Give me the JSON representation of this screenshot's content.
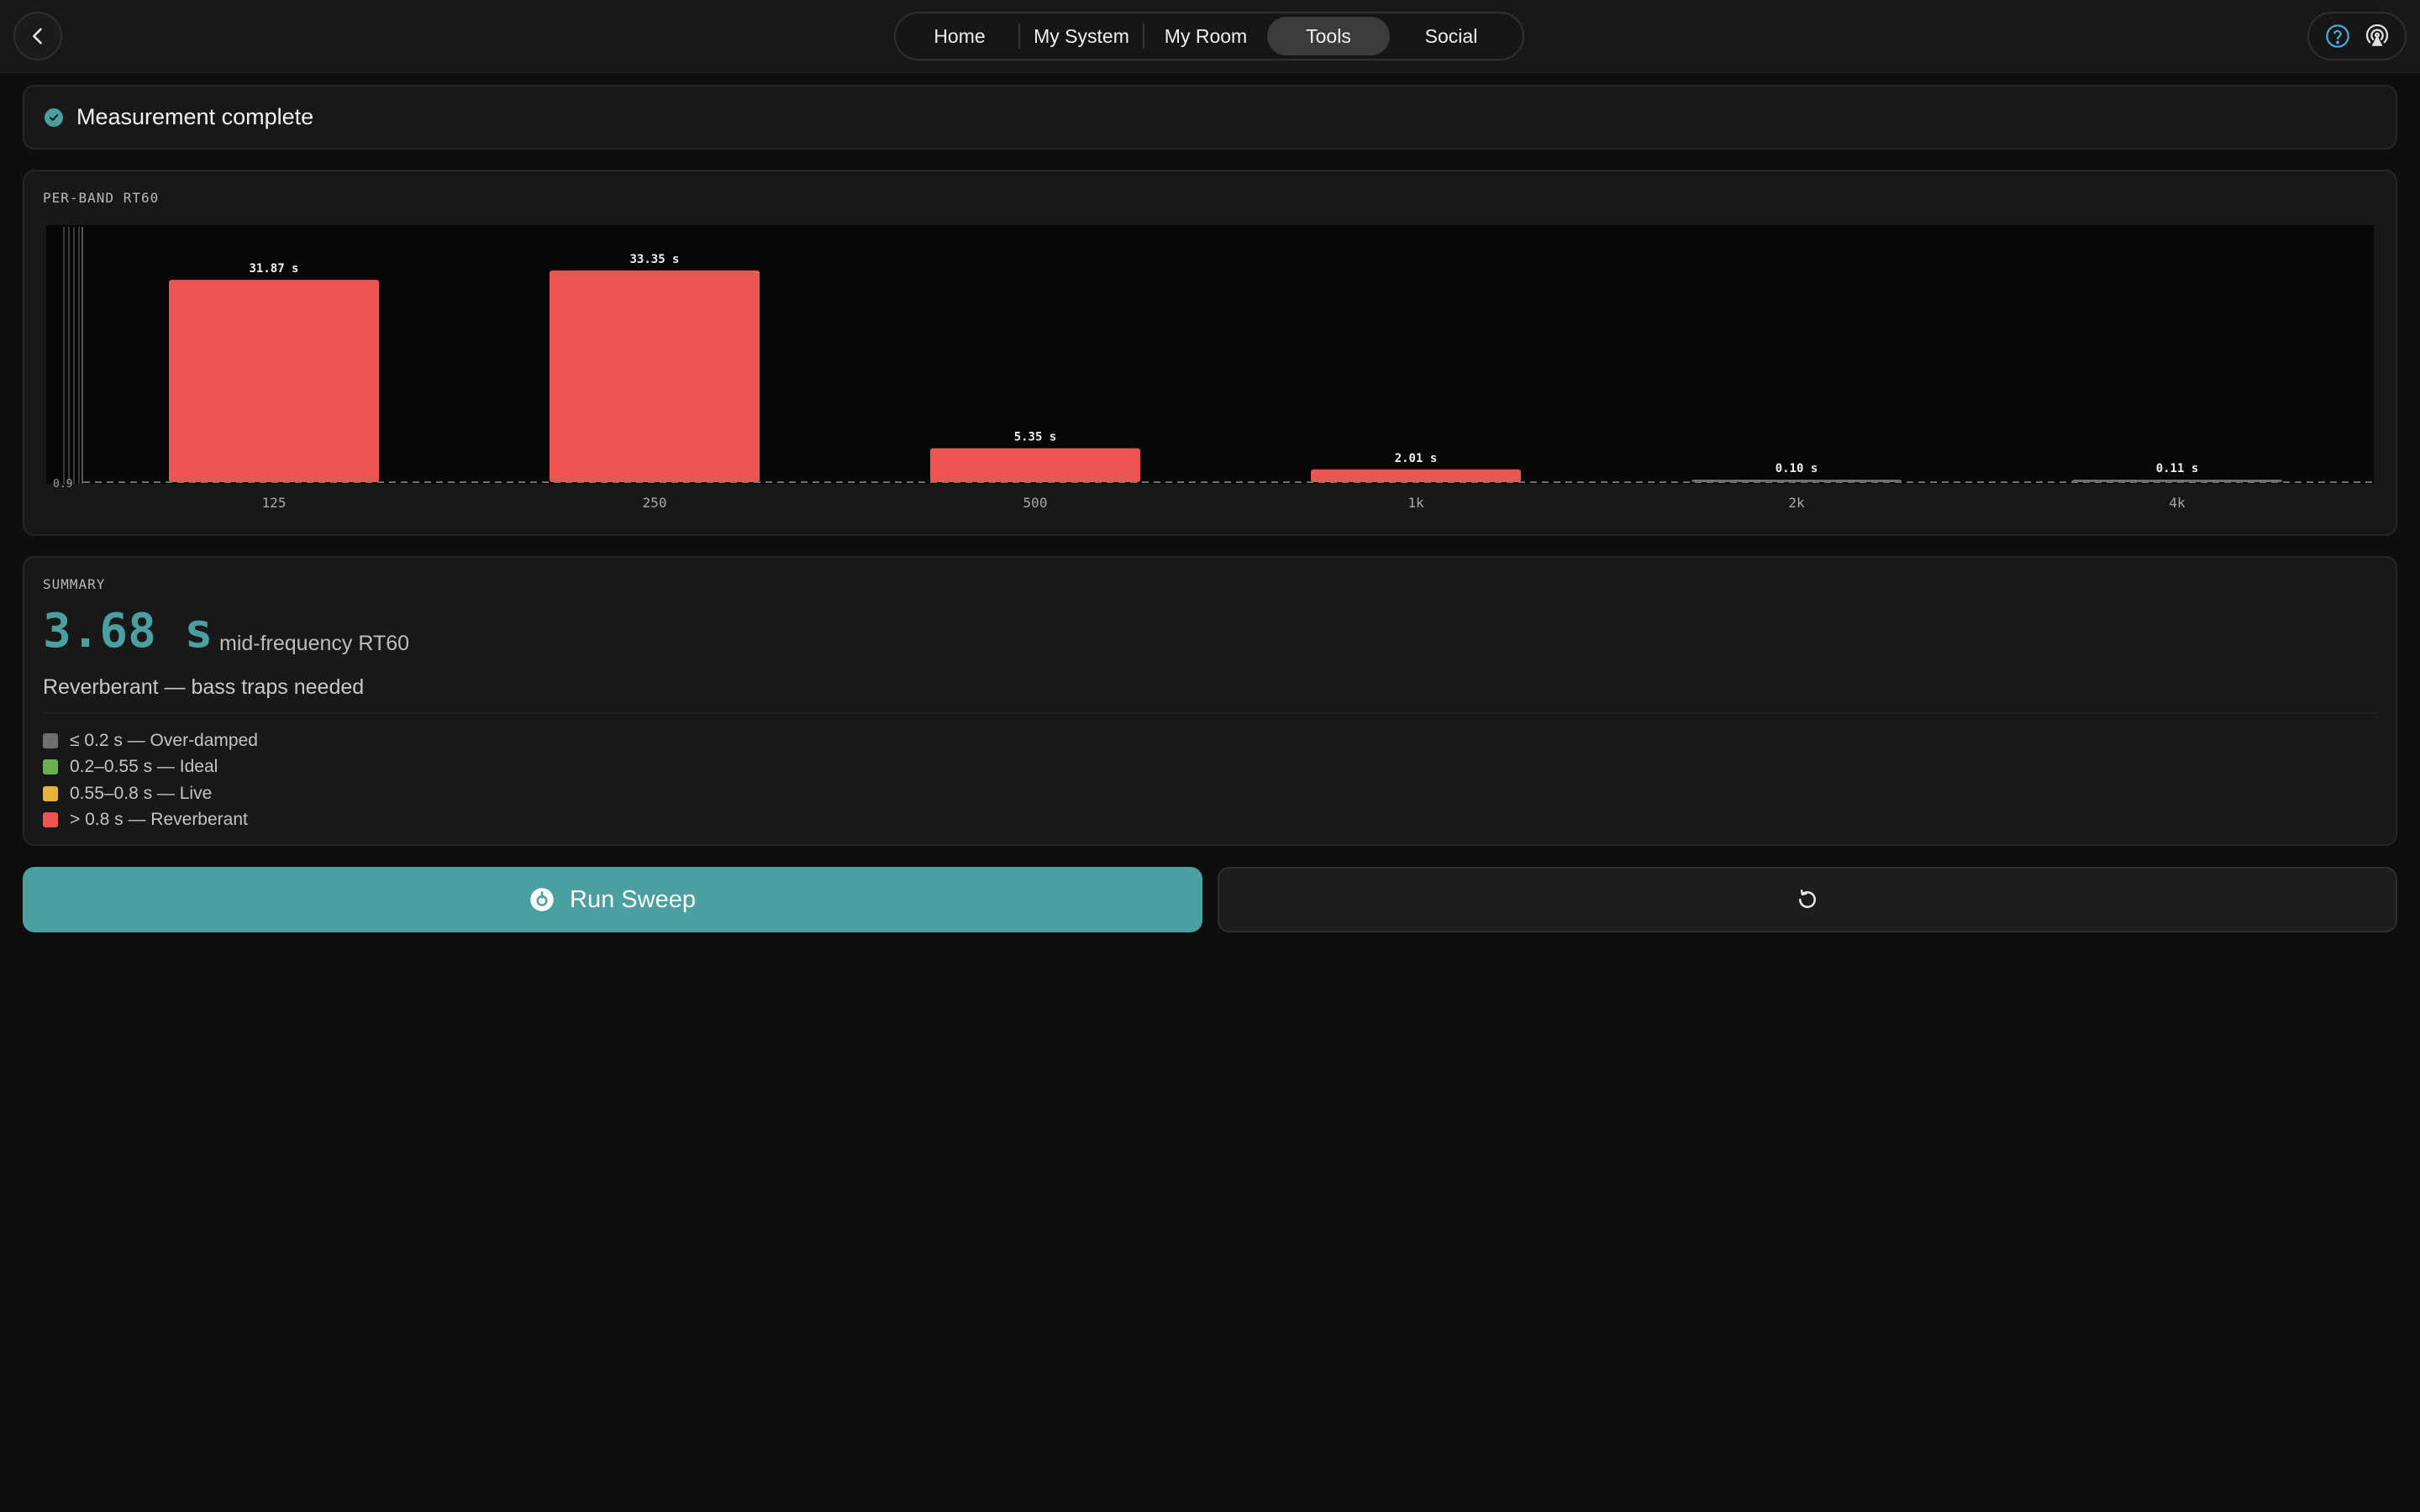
{
  "nav": {
    "tabs": [
      {
        "label": "Home",
        "active": false
      },
      {
        "label": "My System",
        "active": false
      },
      {
        "label": "My Room",
        "active": false
      },
      {
        "label": "Tools",
        "active": true
      },
      {
        "label": "Social",
        "active": false
      }
    ]
  },
  "icons": {
    "back": "chevron-left-icon",
    "help": "help-circle-icon",
    "broadcast": "airplay-icon",
    "status": "check-circle-icon",
    "run": "sweep-icon",
    "reset": "rotate-ccw-icon"
  },
  "status": {
    "text": "Measurement complete"
  },
  "chart": {
    "section_label": "PER-BAND RT60"
  },
  "chart_data": {
    "type": "bar",
    "title": "PER-BAND RT60",
    "categories": [
      "125",
      "250",
      "500",
      "1k",
      "2k",
      "4k"
    ],
    "values": [
      31.87,
      33.35,
      5.35,
      2.01,
      0.1,
      0.11
    ],
    "value_labels": [
      "31.87 s",
      "33.35 s",
      "5.35 s",
      "2.01 s",
      "0.10 s",
      "0.11 s"
    ],
    "reference_line_label": "0.9",
    "ylim": [
      0,
      33.35
    ],
    "xlabel": "",
    "ylabel": "",
    "bar_color": "#ec5552"
  },
  "summary": {
    "section_label": "SUMMARY",
    "value": "3.68 s",
    "value_caption": "mid-frequency RT60",
    "verdict": "Reverberant — bass traps needed",
    "legend": [
      {
        "label": "≤ 0.2 s — Over-damped",
        "color": "#6f6f6f"
      },
      {
        "label": "0.2–0.55 s — Ideal",
        "color": "#6ab04c"
      },
      {
        "label": "0.55–0.8 s — Live",
        "color": "#e6b43a"
      },
      {
        "label": "> 0.8 s — Reverberant",
        "color": "#ec5552"
      }
    ]
  },
  "actions": {
    "run_label": "Run Sweep"
  },
  "colors": {
    "accent": "#4a9fa0",
    "danger": "#ec5552"
  }
}
